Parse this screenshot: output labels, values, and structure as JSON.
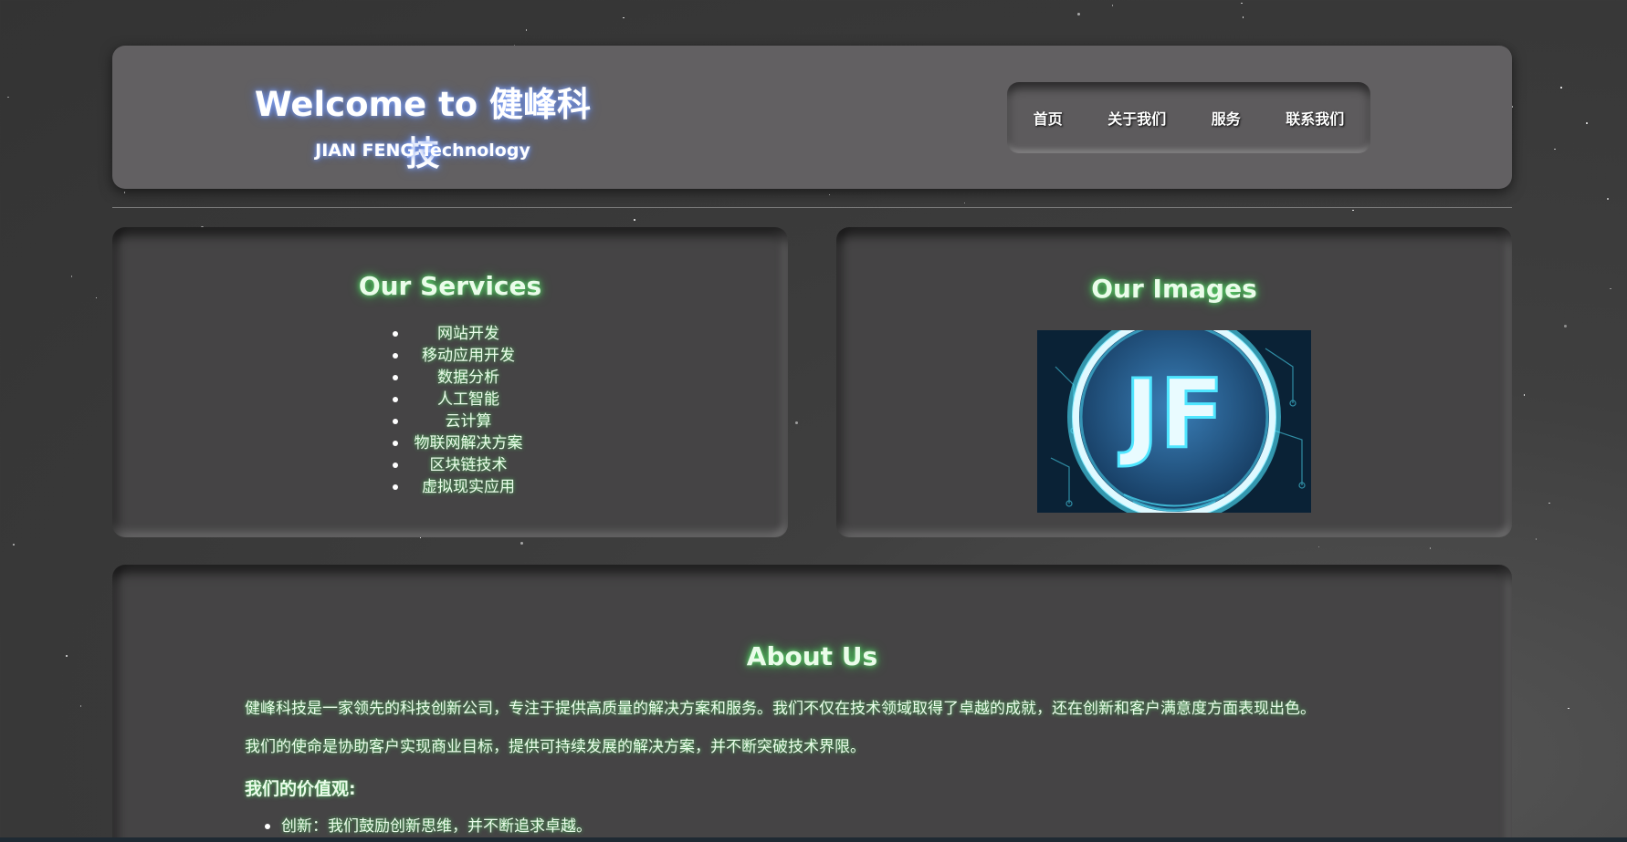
{
  "header": {
    "title": "Welcome to 健峰科技",
    "subtitle": "JIAN FENG Technology",
    "nav": [
      "首页",
      "关于我们",
      "服务",
      "联系我们"
    ]
  },
  "services": {
    "heading": "Our Services",
    "items": [
      "网站开发",
      "移动应用开发",
      "数据分析",
      "人工智能",
      "云计算",
      "物联网解决方案",
      "区块链技术",
      "虚拟现实应用"
    ]
  },
  "images": {
    "heading": "Our Images",
    "logo_text": "JF"
  },
  "about": {
    "heading": "About Us",
    "paragraph1": "健峰科技是一家领先的科技创新公司，专注于提供高质量的解决方案和服务。我们不仅在技术领域取得了卓越的成就，还在创新和客户满意度方面表现出色。",
    "paragraph2": "我们的使命是协助客户实现商业目标，提供可持续发展的解决方案，并不断突破技术界限。",
    "values_heading": "我们的价值观:",
    "values": [
      "创新：我们鼓励创新思维，并不断追求卓越。"
    ]
  },
  "colors": {
    "background": "#3a3a3a",
    "header_bg": "#626062",
    "card_bg": "#454445",
    "title_glow": "#4a6fd8",
    "heading_glow": "#3bbf4d",
    "logo_cyan": "#4fe6ff"
  }
}
